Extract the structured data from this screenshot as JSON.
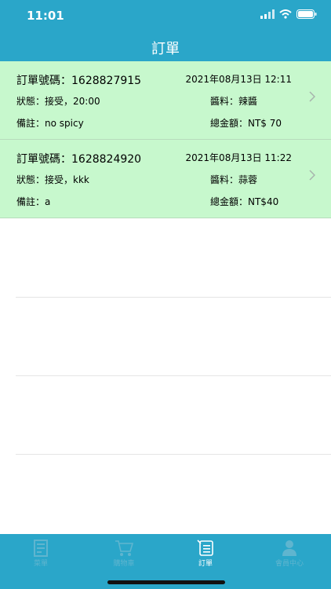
{
  "status_bar": {
    "time": "11:01"
  },
  "header": {
    "title": "訂單"
  },
  "orders": [
    {
      "order_no": "訂單號碼：1628827915",
      "date": "2021年08月13日 12:11",
      "status": "狀態：接受，20:00",
      "sauce": "醬料：辣醬",
      "note": "備註：no spicy",
      "total": "總金額：NT$ 70"
    },
    {
      "order_no": "訂單號碼：1628824920",
      "date": "2021年08月13日 11:22",
      "status": "狀態：接受，kkk",
      "sauce": "醬料：蒜蓉",
      "note": "備註：a",
      "total": "總金額：NT$40"
    }
  ],
  "tabs": [
    {
      "label": "菜單",
      "icon": "menu-document-icon",
      "active": false
    },
    {
      "label": "購物車",
      "icon": "cart-icon",
      "active": false
    },
    {
      "label": "訂單",
      "icon": "order-list-icon",
      "active": true
    },
    {
      "label": "會員中心",
      "icon": "member-icon",
      "active": false
    }
  ],
  "colors": {
    "header_bg": "#2aa6c9",
    "order_bg": "#c7f8cd",
    "tab_inactive": "#5fb5cf",
    "tab_active": "#ffffff"
  }
}
